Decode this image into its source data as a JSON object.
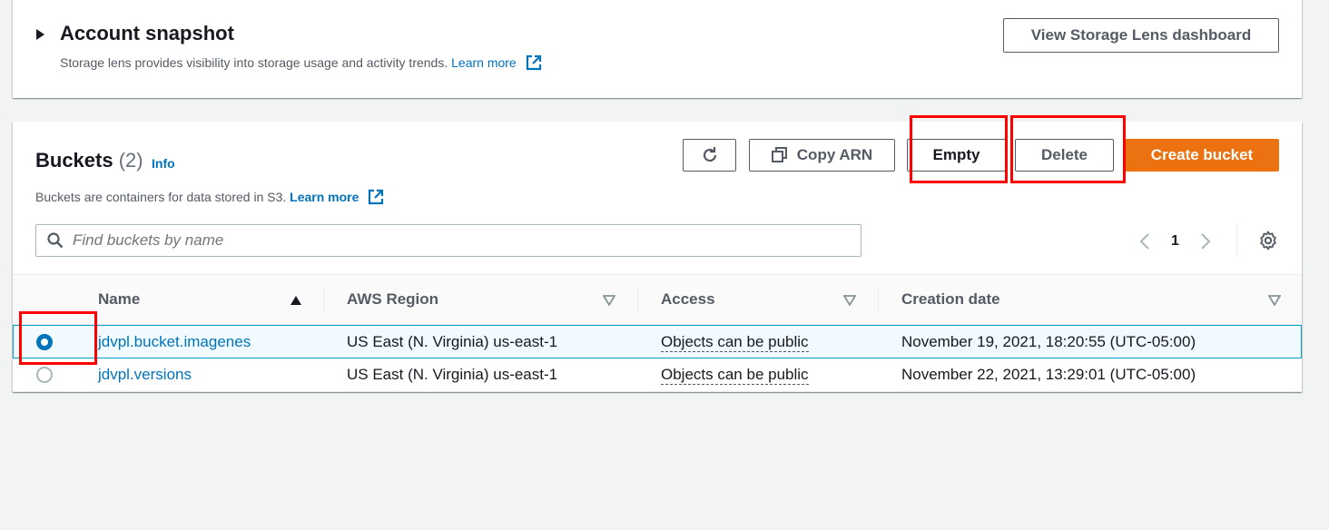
{
  "snapshot": {
    "title": "Account snapshot",
    "description": "Storage lens provides visibility into storage usage and activity trends.",
    "learn_more": "Learn more",
    "lens_button": "View Storage Lens dashboard"
  },
  "buckets": {
    "title": "Buckets",
    "count": "(2)",
    "info": "Info",
    "description": "Buckets are containers for data stored in S3.",
    "learn_more": "Learn more",
    "copy_arn": "Copy ARN",
    "empty": "Empty",
    "delete": "Delete",
    "create": "Create bucket"
  },
  "search": {
    "placeholder": "Find buckets by name"
  },
  "pager": {
    "page": "1"
  },
  "table": {
    "headers": [
      "Name",
      "AWS Region",
      "Access",
      "Creation date"
    ],
    "rows": [
      {
        "name": "jdvpl.bucket.imagenes",
        "region": "US East (N. Virginia) us-east-1",
        "access": "Objects can be public",
        "created": "November 19, 2021, 18:20:55 (UTC-05:00)",
        "selected": true
      },
      {
        "name": "jdvpl.versions",
        "region": "US East (N. Virginia) us-east-1",
        "access": "Objects can be public",
        "created": "November 22, 2021, 13:29:01 (UTC-05:00)",
        "selected": false
      }
    ]
  },
  "colors": {
    "accent": "#0073bb",
    "primary_button": "#ec7211",
    "highlight": "#ff0000"
  }
}
